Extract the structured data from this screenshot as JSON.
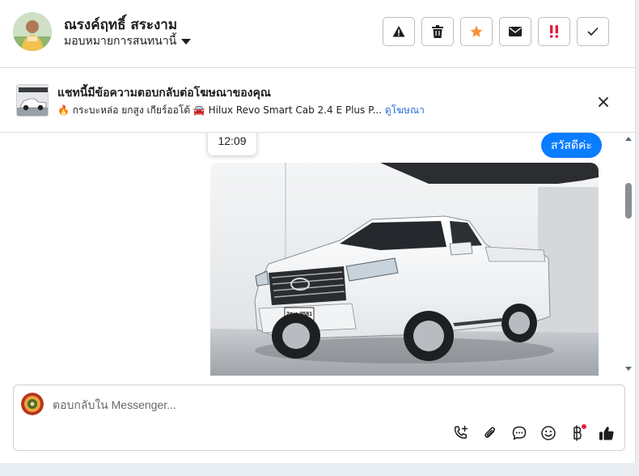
{
  "header": {
    "name": "ณรงค์ฤทธิ์ สระงาม",
    "assign_label": "มอบหมายการสนทนานี้",
    "toolbar_icons": [
      "warning-icon",
      "trash-icon",
      "star-icon",
      "envelope-icon",
      "double-exclamation-icon",
      "check-icon"
    ],
    "star_color": "#f7923b",
    "alert_color": "#e41e3f"
  },
  "ad_bar": {
    "title": "แชทนี้มีข้อความตอบกลับต่อโฆษณาของคุณ",
    "subtitle": "🔥 กระบะหล่อ ยกสูง เกียร์ออโต้ 🚘 Hilux Revo Smart Cab 2.4 E Plus P...",
    "link_label": "ดูโฆษณา"
  },
  "chat": {
    "timestamp": "12:09",
    "outgoing_message": "สวัสดีค่ะ",
    "bubble_color": "#0a7cff",
    "photo": {
      "plate_line1": "2ฒธ 9581",
      "plate_line2": "กรุงเทพมหานคร"
    }
  },
  "composer": {
    "placeholder": "ตอบกลับใน Messenger...",
    "icons": [
      "phone-plus-icon",
      "paperclip-icon",
      "chat-bubble-icon",
      "emoji-icon",
      "baht-icon",
      "thumbs-up-icon"
    ]
  }
}
